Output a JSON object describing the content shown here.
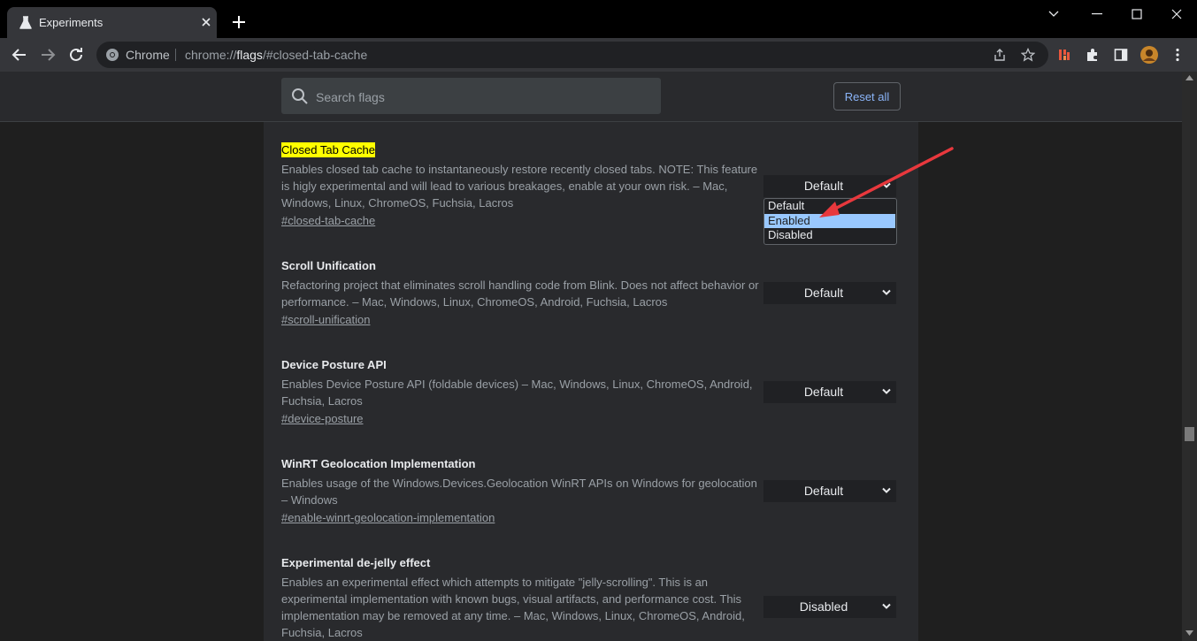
{
  "tab": {
    "title": "Experiments"
  },
  "omnibox": {
    "site": "Chrome",
    "url_prefix": "chrome://",
    "url_host": "flags",
    "url_suffix": "/#closed-tab-cache"
  },
  "search": {
    "placeholder": "Search flags"
  },
  "reset_label": "Reset all",
  "experiments": [
    {
      "name": "Closed Tab Cache",
      "highlighted": true,
      "description": "Enables closed tab cache to instantaneously restore recently closed tabs. NOTE: This feature is higly experimental and will lead to various breakages, enable at your own risk. – Mac, Windows, Linux, ChromeOS, Fuchsia, Lacros",
      "link": "#closed-tab-cache",
      "value": "Default"
    },
    {
      "name": "Scroll Unification",
      "description": "Refactoring project that eliminates scroll handling code from Blink. Does not affect behavior or performance. – Mac, Windows, Linux, ChromeOS, Android, Fuchsia, Lacros",
      "link": "#scroll-unification",
      "value": "Default"
    },
    {
      "name": "Device Posture API",
      "description": "Enables Device Posture API (foldable devices) – Mac, Windows, Linux, ChromeOS, Android, Fuchsia, Lacros",
      "link": "#device-posture",
      "value": "Default"
    },
    {
      "name": "WinRT Geolocation Implementation",
      "description": "Enables usage of the Windows.Devices.Geolocation WinRT APIs on Windows for geolocation – Windows",
      "link": "#enable-winrt-geolocation-implementation",
      "value": "Default"
    },
    {
      "name": "Experimental de-jelly effect",
      "description": "Enables an experimental effect which attempts to mitigate \"jelly-scrolling\". This is an experimental implementation with known bugs, visual artifacts, and performance cost. This implementation may be removed at any time. – Mac, Windows, Linux, ChromeOS, Android, Fuchsia, Lacros",
      "link": "",
      "value": "Disabled"
    }
  ],
  "dropdown": {
    "options": [
      "Default",
      "Enabled",
      "Disabled"
    ],
    "selected": "Enabled"
  },
  "colors": {
    "highlight": "#ffff00",
    "annotation_arrow": "#e8383d",
    "selected_option": "#99c8ff",
    "link_accent": "#8ab4f8"
  }
}
